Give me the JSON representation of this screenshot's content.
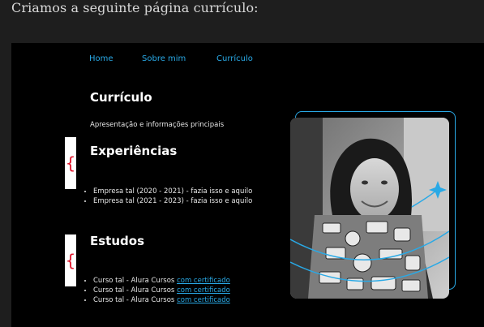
{
  "intro_text": "Criamos a seguinte página currículo:",
  "nav": [
    {
      "label": "Home"
    },
    {
      "label": "Sobre mim"
    },
    {
      "label": "Currículo"
    }
  ],
  "page_title": "Currículo",
  "subtitle": "Apresentação e informações principais",
  "experiences": {
    "heading": "Experiências",
    "items": [
      "Empresa tal (2020 - 2021) - fazia isso e aquilo",
      "Empresa tal (2021 - 2023) - fazia isso e aquilo"
    ]
  },
  "studies": {
    "heading": "Estudos",
    "items": [
      {
        "text": "Curso tal - Alura Cursos ",
        "link": "com certificado"
      },
      {
        "text": "Curso tal - Alura Cursos ",
        "link": "com certificado"
      },
      {
        "text": "Curso tal - Alura Cursos ",
        "link": "com certificado"
      }
    ]
  },
  "brace_glyph": "{",
  "colors": {
    "accent": "#29a9e6",
    "brace": "#e0152b",
    "background": "#000000"
  }
}
